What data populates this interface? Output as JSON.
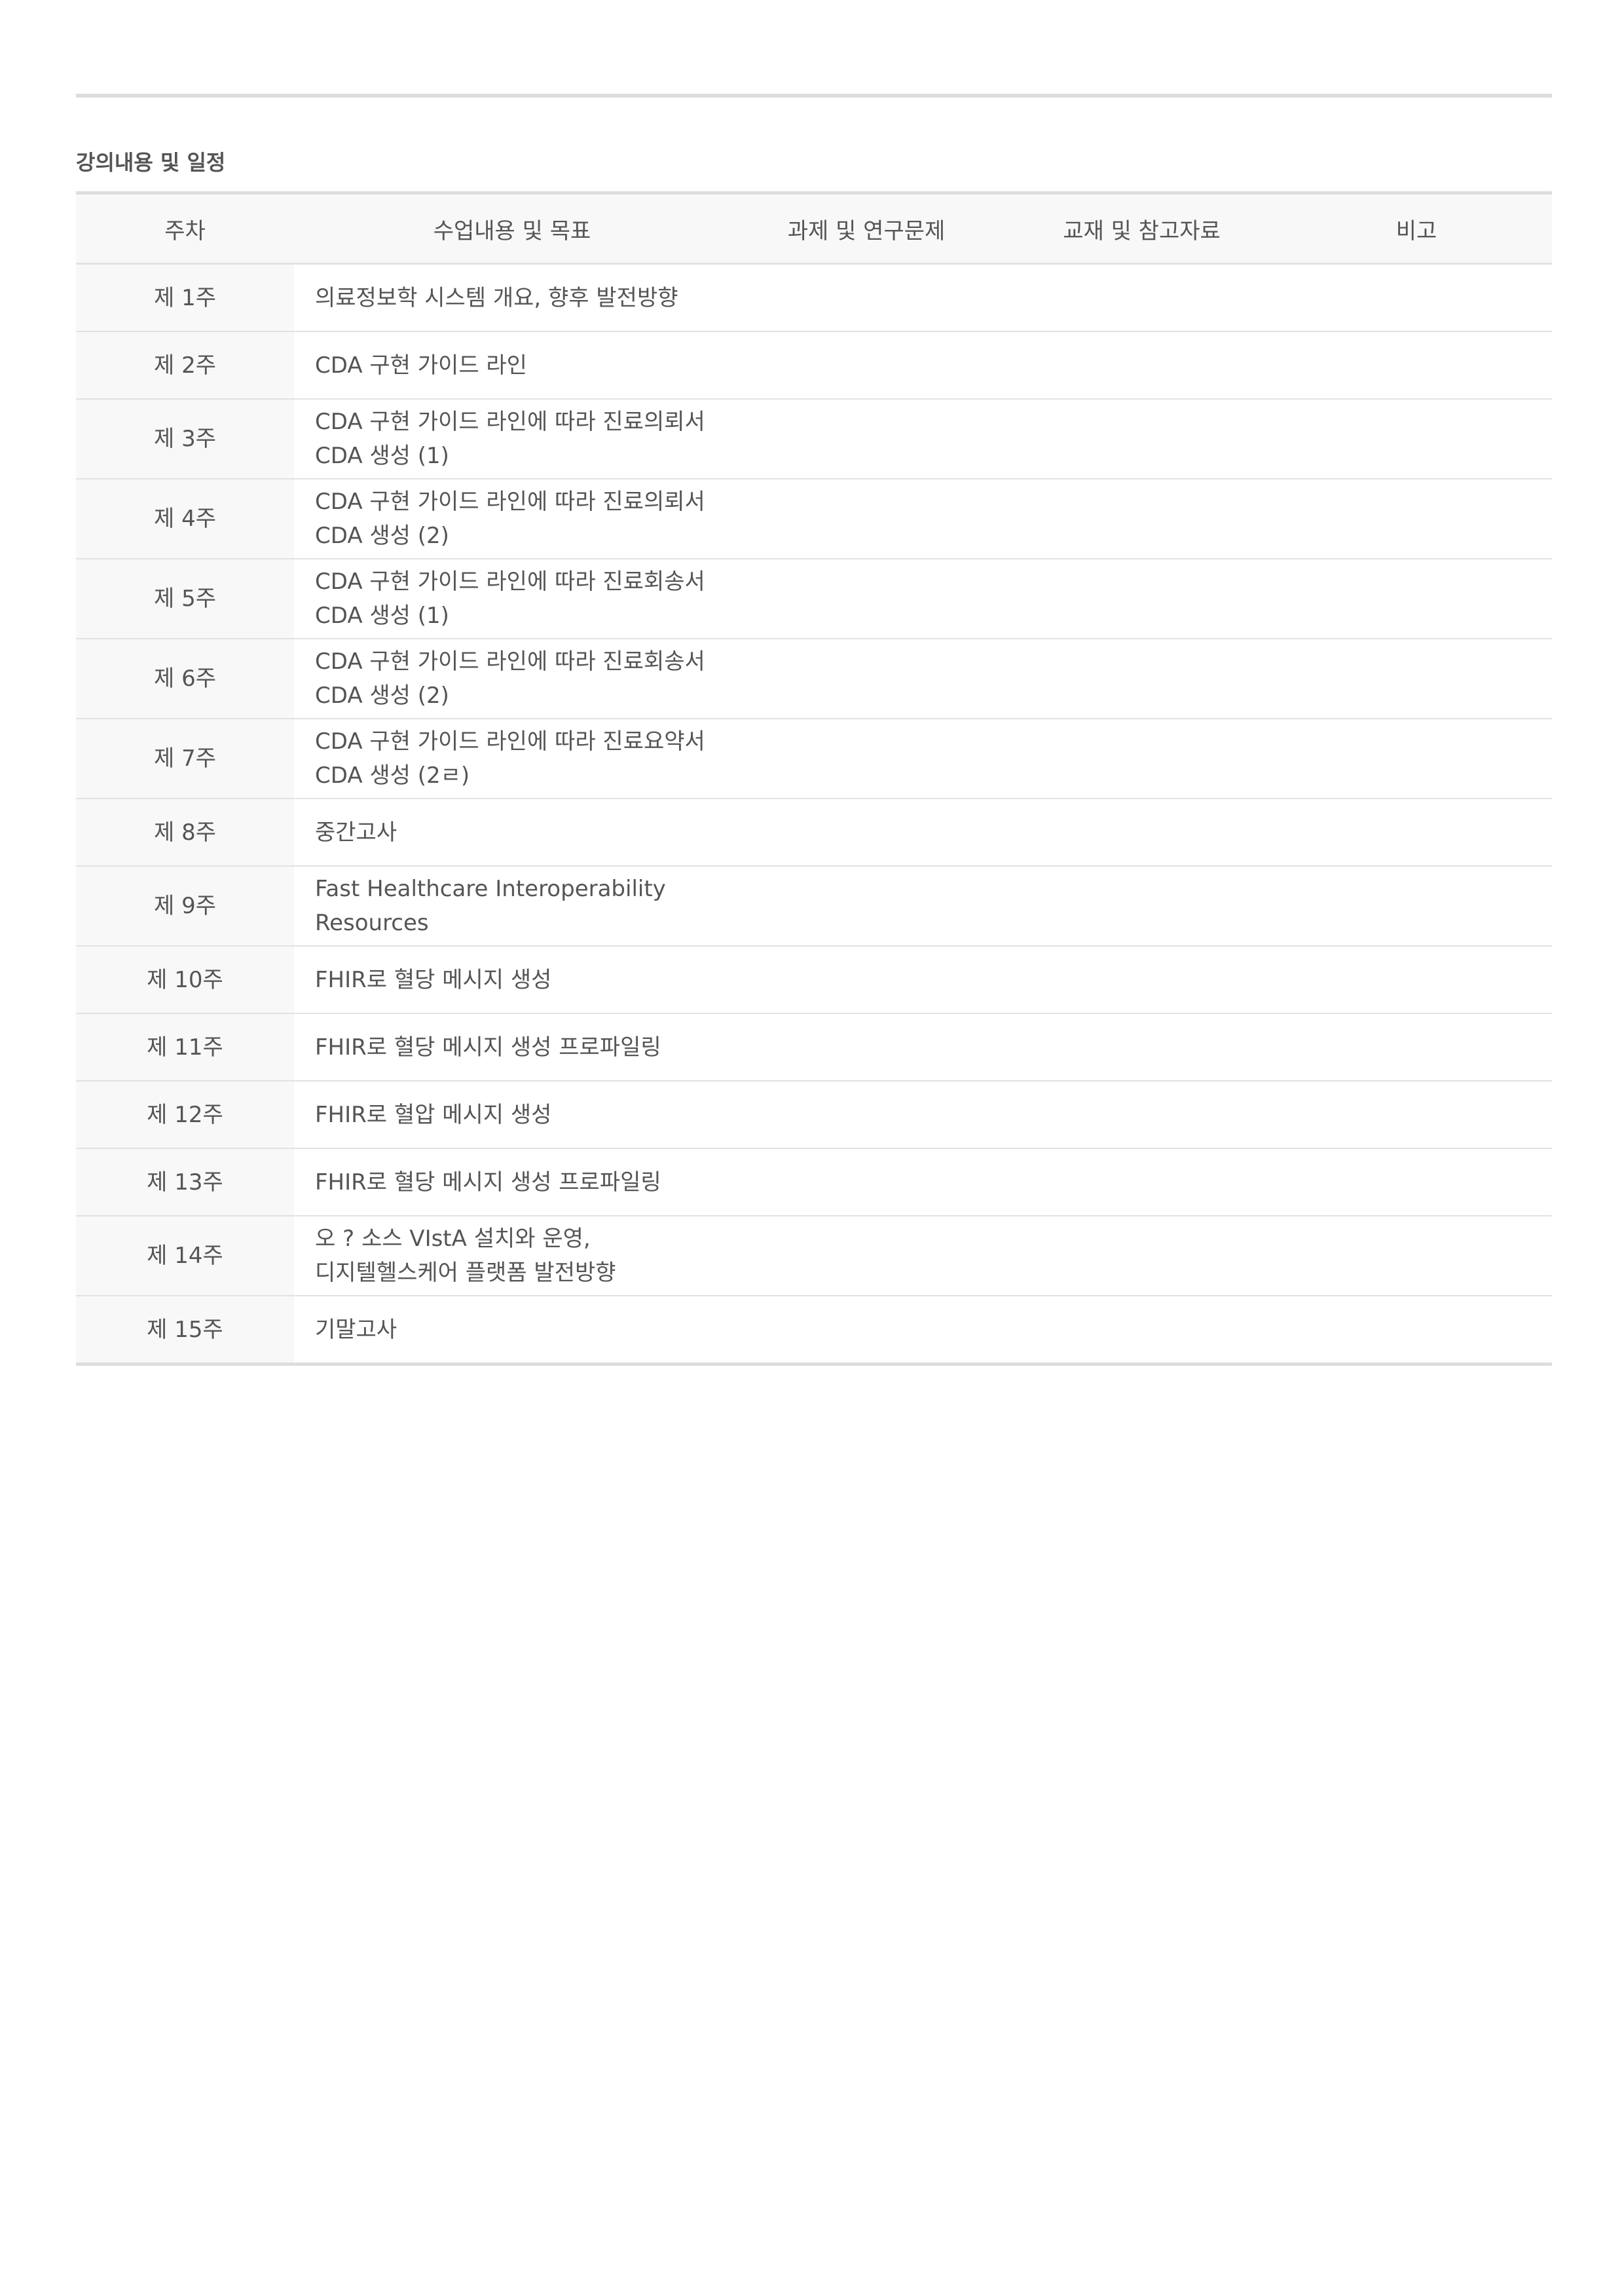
{
  "section_title": "강의내용 및 일정",
  "table": {
    "headers": [
      "주차",
      "수업내용 및 목표",
      "과제 및 연구문제",
      "교재 및 참고자료",
      "비고"
    ],
    "rows": [
      {
        "week": "제 1주",
        "content": [
          "의료정보학 시스템 개요, 향후 발전방향"
        ],
        "assignment": "",
        "materials": "",
        "notes": ""
      },
      {
        "week": "제 2주",
        "content": [
          "CDA 구현 가이드 라인"
        ],
        "assignment": "",
        "materials": "",
        "notes": ""
      },
      {
        "week": "제 3주",
        "content": [
          "CDA 구현 가이드 라인에 따라 진료의뢰서",
          "CDA 생성 (1)"
        ],
        "assignment": "",
        "materials": "",
        "notes": ""
      },
      {
        "week": "제 4주",
        "content": [
          "CDA 구현 가이드 라인에 따라 진료의뢰서",
          "CDA 생성 (2)"
        ],
        "assignment": "",
        "materials": "",
        "notes": ""
      },
      {
        "week": "제 5주",
        "content": [
          "CDA 구현 가이드 라인에 따라 진료회송서",
          "CDA 생성 (1)"
        ],
        "assignment": "",
        "materials": "",
        "notes": ""
      },
      {
        "week": "제 6주",
        "content": [
          "CDA 구현 가이드 라인에 따라 진료회송서",
          "CDA 생성 (2)"
        ],
        "assignment": "",
        "materials": "",
        "notes": ""
      },
      {
        "week": "제 7주",
        "content": [
          "CDA 구현 가이드 라인에 따라 진료요약서",
          "CDA 생성 (2ㄹ)"
        ],
        "assignment": "",
        "materials": "",
        "notes": ""
      },
      {
        "week": "제 8주",
        "content": [
          "중간고사"
        ],
        "assignment": "",
        "materials": "",
        "notes": ""
      },
      {
        "week": "제 9주",
        "content": [
          "Fast Healthcare Interoperability",
          "Resources"
        ],
        "assignment": "",
        "materials": "",
        "notes": ""
      },
      {
        "week": "제 10주",
        "content": [
          "FHIR로 혈당 메시지 생성"
        ],
        "assignment": "",
        "materials": "",
        "notes": ""
      },
      {
        "week": "제 11주",
        "content": [
          "FHIR로 혈당 메시지 생성 프로파일링"
        ],
        "assignment": "",
        "materials": "",
        "notes": ""
      },
      {
        "week": "제 12주",
        "content": [
          "FHIR로 혈압 메시지 생성"
        ],
        "assignment": "",
        "materials": "",
        "notes": ""
      },
      {
        "week": "제 13주",
        "content": [
          "FHIR로 혈당 메시지 생성 프로파일링"
        ],
        "assignment": "",
        "materials": "",
        "notes": ""
      },
      {
        "week": "제 14주",
        "content": [
          "오 ? 소스 VIstA 설치와 운영,",
          "디지텔헬스케어 플랫폼 발전방향"
        ],
        "assignment": "",
        "materials": "",
        "notes": ""
      },
      {
        "week": "제 15주",
        "content": [
          "기말고사"
        ],
        "assignment": "",
        "materials": "",
        "notes": ""
      }
    ]
  }
}
